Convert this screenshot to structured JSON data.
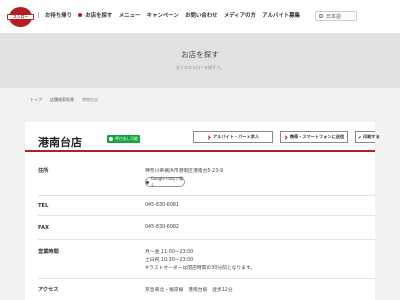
{
  "header": {
    "logo_text": "スシロー",
    "nav": [
      "お持ち帰り",
      "お店を探す",
      "メニュー",
      "キャンペーン",
      "お問い合わせ",
      "メディアの方",
      "アルバイト募集"
    ],
    "language": "日本語"
  },
  "hero": {
    "title": "お店を探す",
    "subtitle": "近くのスシローを探そう。"
  },
  "breadcrumb": [
    "トップ",
    "店舗検索結果",
    "港南台店"
  ],
  "store": {
    "name": "港南台店",
    "tag": "呼び出し可能",
    "buttons": {
      "job": "アルバイト・パート求人",
      "send": "携帯・スマートフォンに送信",
      "print": "印刷する"
    }
  },
  "details": {
    "address_label": "住所",
    "address": "神奈川県横浜市港南区港南台5-23-9",
    "map_button": "Google mapで開く",
    "tel_label": "TEL",
    "tel": "045-830-6081",
    "fax_label": "FAX",
    "fax": "045-830-6082",
    "hours_label": "営業時間",
    "hours": [
      "月～金 11:00～23:00",
      "土日祝 10:30～23:00",
      "※ラストオーダーは閉店時間の30分前となります。"
    ],
    "access_label": "アクセス",
    "access": "京急東北・根岸線　港南台駅　徒歩12分"
  },
  "colors": {
    "brand": "#b51f24",
    "tag": "#13a43d"
  }
}
